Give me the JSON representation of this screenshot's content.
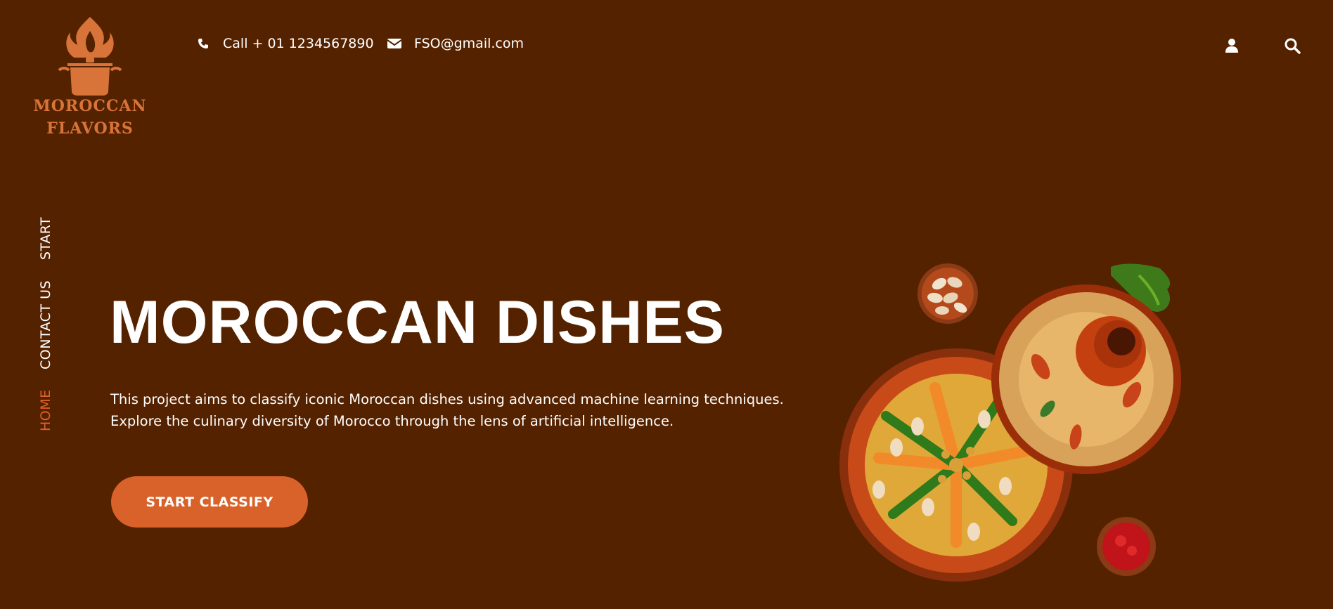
{
  "brand": {
    "line1": "MOROCCAN",
    "line2": "FLAVORS"
  },
  "header": {
    "phone": "Call + 01 1234567890",
    "email": "FSO@gmail.com",
    "icons": [
      "phone-icon",
      "envelope-icon",
      "user-icon",
      "search-icon"
    ]
  },
  "nav": {
    "start": "START",
    "contact": "CONTACT US",
    "home": "HOME",
    "active": "HOME"
  },
  "hero": {
    "title": "MOROCCAN DISHES",
    "desc_line1": "This project aims to classify iconic Moroccan dishes using advanced machine learning techniques.",
    "desc_line2": "Explore the culinary diversity of Morocco through the lens of artificial intelligence.",
    "cta": "START CLASSIFY"
  },
  "colors": {
    "background": "#552200",
    "accent": "#d9622a",
    "logo": "#d8743a",
    "text": "#ffffff"
  }
}
